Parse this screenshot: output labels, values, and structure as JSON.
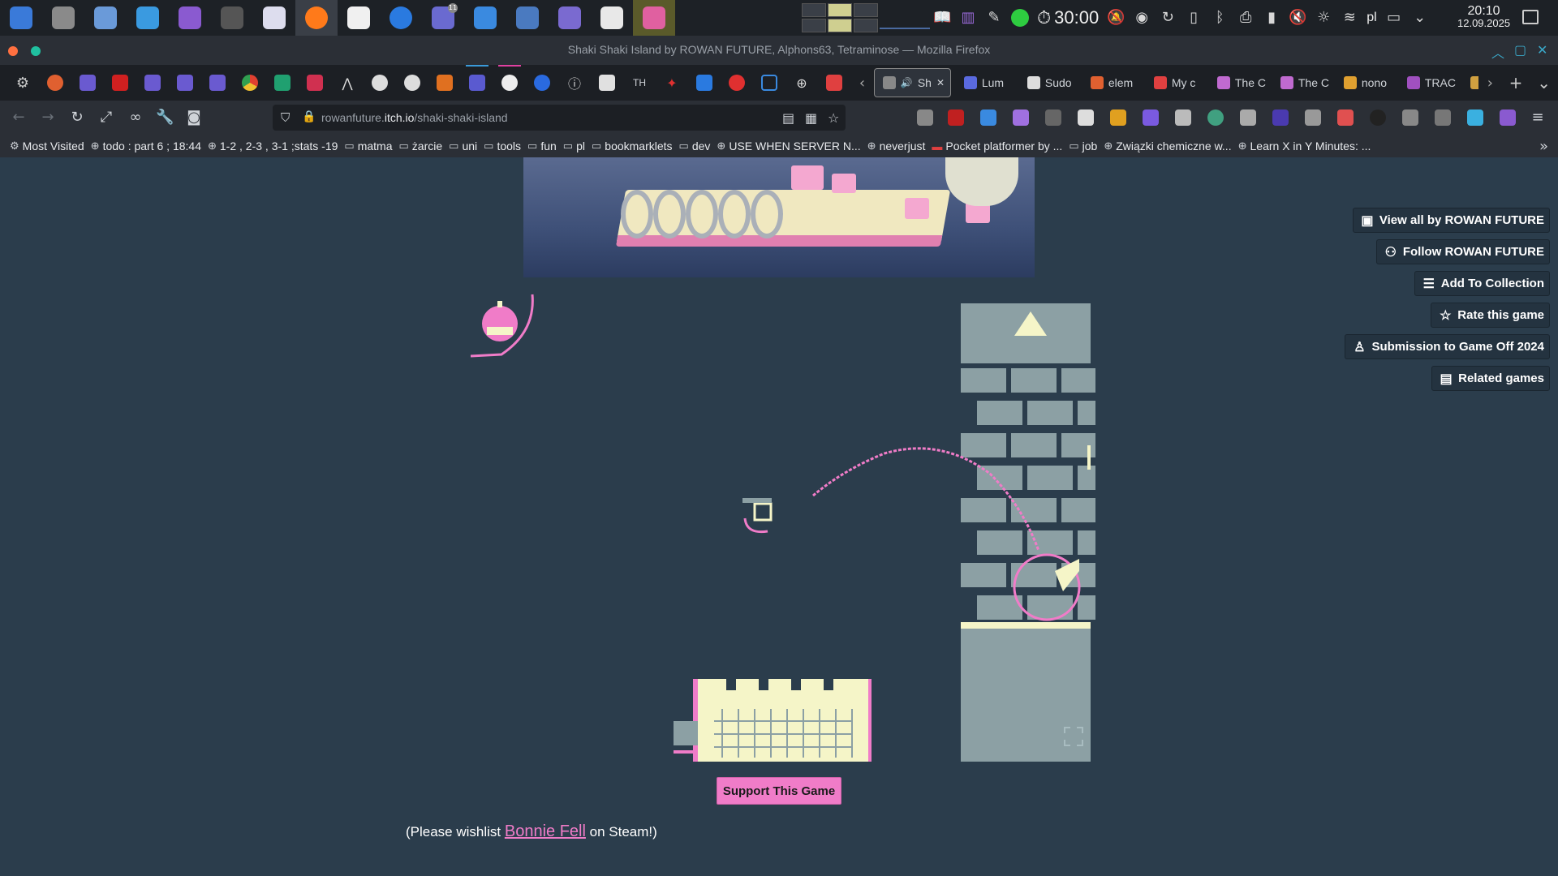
{
  "taskbar": {
    "apps": [
      {
        "name": "app-launcher-icon",
        "color": "#3a7ad9"
      },
      {
        "name": "system-settings-icon",
        "color": "#8a8a8a"
      },
      {
        "name": "notes-app-icon",
        "color": "#6a9ad9"
      },
      {
        "name": "file-manager-icon",
        "color": "#3a9ae0"
      },
      {
        "name": "document-app-icon",
        "color": "#8a5ad0"
      },
      {
        "name": "terminal-icon",
        "color": "#555"
      },
      {
        "name": "vpn-app-icon",
        "color": "#dde"
      },
      {
        "name": "firefox-icon",
        "color": "#ff7a1a"
      },
      {
        "name": "brush-app-icon",
        "color": "#f0f0f0"
      },
      {
        "name": "browser-icon",
        "color": "#2a7ae0"
      },
      {
        "name": "discord-app-icon",
        "color": "#6a6ad0"
      },
      {
        "name": "chat-app-icon",
        "color": "#3a8ae0"
      },
      {
        "name": "package-app-icon",
        "color": "#4a7ac0"
      },
      {
        "name": "editor-app-icon",
        "color": "#7a6ad0"
      },
      {
        "name": "viewer-app-icon",
        "color": "#e8e8e8"
      },
      {
        "name": "screenshot-app-icon",
        "color": "#e060a0"
      }
    ],
    "discord_badge": "11",
    "timer": "30:00",
    "language": "pl",
    "time": "20:10",
    "date": "12.09.2025"
  },
  "window": {
    "title": "Shaki Shaki Island by ROWAN FUTURE, Alphons63, Tetraminose — Mozilla Firefox"
  },
  "tabs": {
    "pinned_text": [
      "TH"
    ],
    "items": [
      {
        "label": "Sh",
        "active": true,
        "color": "#888"
      },
      {
        "label": "Lum",
        "active": false,
        "color": "#5a6ae0"
      },
      {
        "label": "Sudo",
        "active": false,
        "color": "#ddd"
      },
      {
        "label": "elem",
        "active": false,
        "color": "#e06030"
      },
      {
        "label": "My c",
        "active": false,
        "color": "#e04040"
      },
      {
        "label": "The C",
        "active": false,
        "color": "#c06ad0"
      },
      {
        "label": "The C",
        "active": false,
        "color": "#c06ad0"
      },
      {
        "label": "nono",
        "active": false,
        "color": "#e0a030"
      },
      {
        "label": "TRAC",
        "active": false,
        "color": "#a050c0"
      },
      {
        "label": "",
        "active": false,
        "color": "#d0a040"
      }
    ]
  },
  "navbar": {
    "url_prefix": "rowanfuture.",
    "url_domain": "itch.io",
    "url_path": "/shaki-shaki-island"
  },
  "bookmarks": [
    {
      "label": "Most Visited",
      "icon": "⚙"
    },
    {
      "label": "todo : part 6 ; 18:44",
      "icon": "⊕"
    },
    {
      "label": "1-2 , 2-3 , 3-1 ;stats -19",
      "icon": "⊕"
    },
    {
      "label": "matma",
      "icon": "▭"
    },
    {
      "label": "żarcie",
      "icon": "▭"
    },
    {
      "label": "uni",
      "icon": "▭"
    },
    {
      "label": "tools",
      "icon": "▭"
    },
    {
      "label": "fun",
      "icon": "▭"
    },
    {
      "label": "pl",
      "icon": "▭"
    },
    {
      "label": "bookmarklets",
      "icon": "▭"
    },
    {
      "label": "dev",
      "icon": "▭"
    },
    {
      "label": "USE WHEN SERVER N...",
      "icon": "⊕"
    },
    {
      "label": "neverjust",
      "icon": "⊕"
    },
    {
      "label": "Pocket platformer by ...",
      "icon": "▬"
    },
    {
      "label": "job",
      "icon": "▭"
    },
    {
      "label": "Związki chemiczne w...",
      "icon": "⊕"
    },
    {
      "label": "Learn X in Y Minutes: ...",
      "icon": "⊕"
    }
  ],
  "sidebar_buttons": [
    {
      "name": "view-all-button",
      "label": "View all by ROWAN FUTURE",
      "icon": "▣"
    },
    {
      "name": "follow-button",
      "label": "Follow ROWAN FUTURE",
      "icon": "⚇"
    },
    {
      "name": "add-to-collection-button",
      "label": "Add To Collection",
      "icon": "☰"
    },
    {
      "name": "rate-button",
      "label": "Rate this game",
      "icon": "☆"
    },
    {
      "name": "submission-button",
      "label": "Submission to Game Off 2024",
      "icon": "♙"
    },
    {
      "name": "related-games-button",
      "label": "Related games",
      "icon": "▤"
    }
  ],
  "support_button": "Support This Game",
  "wishlist": {
    "before": "(Please wishlist ",
    "link": "Bonnie Fell",
    "after": " on Steam!)"
  },
  "colors": {
    "page_bg": "#2b3d4c",
    "accent_pink": "#f07cc8",
    "game_cream": "#f5f5c8",
    "game_slate": "#8ca0a4"
  }
}
